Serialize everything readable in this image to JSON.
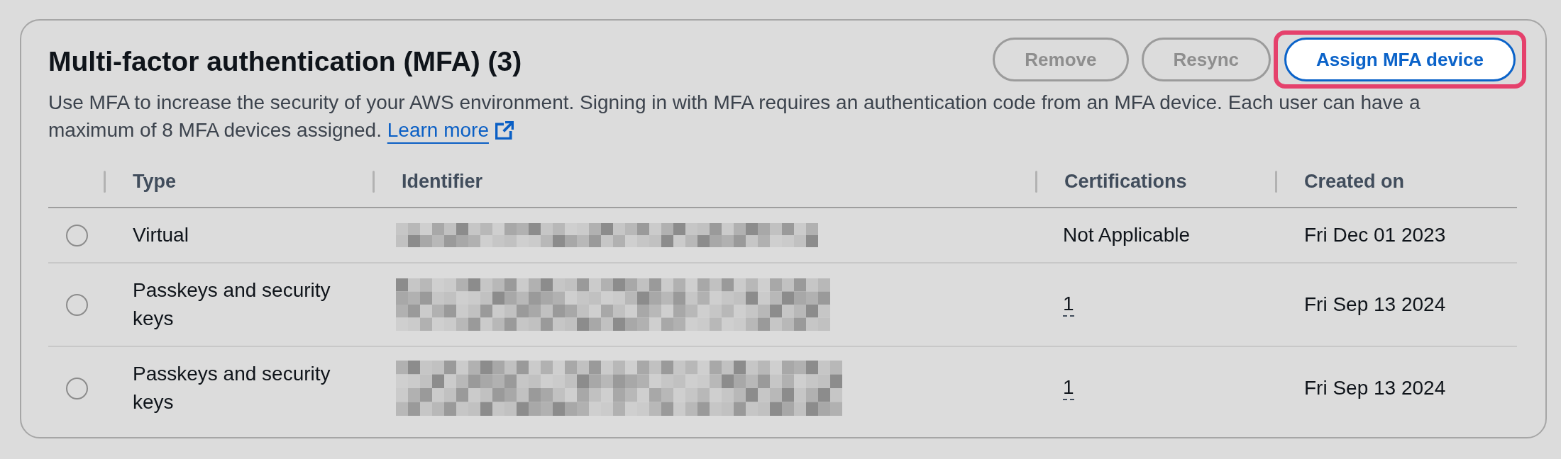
{
  "panel": {
    "title": "Multi-factor authentication (MFA) (3)",
    "description": "Use MFA to increase the security of your AWS environment. Signing in with MFA requires an authentication code from an MFA device. Each user can have a maximum of 8 MFA devices assigned.",
    "learn_more": "Learn more"
  },
  "actions": [
    {
      "label": "Remove",
      "disabled": true,
      "highlighted": false
    },
    {
      "label": "Resync",
      "disabled": true,
      "highlighted": false
    },
    {
      "label": "Assign MFA device",
      "disabled": false,
      "highlighted": true
    }
  ],
  "table": {
    "columns": [
      "Type",
      "Identifier",
      "Certifications",
      "Created on"
    ],
    "rows": [
      {
        "selected": false,
        "type": "Virtual",
        "certifications": {
          "kind": "plain",
          "text": "Not Applicable"
        },
        "created_on": "Fri Dec 01 2023"
      },
      {
        "selected": false,
        "type": "Passkeys and security keys",
        "certifications": {
          "kind": "popover",
          "text": "1"
        },
        "created_on": "Fri Sep 13 2024"
      },
      {
        "selected": false,
        "type": "Passkeys and security keys",
        "certifications": {
          "kind": "popover",
          "text": "1"
        },
        "created_on": "Fri Sep 13 2024"
      }
    ]
  }
}
